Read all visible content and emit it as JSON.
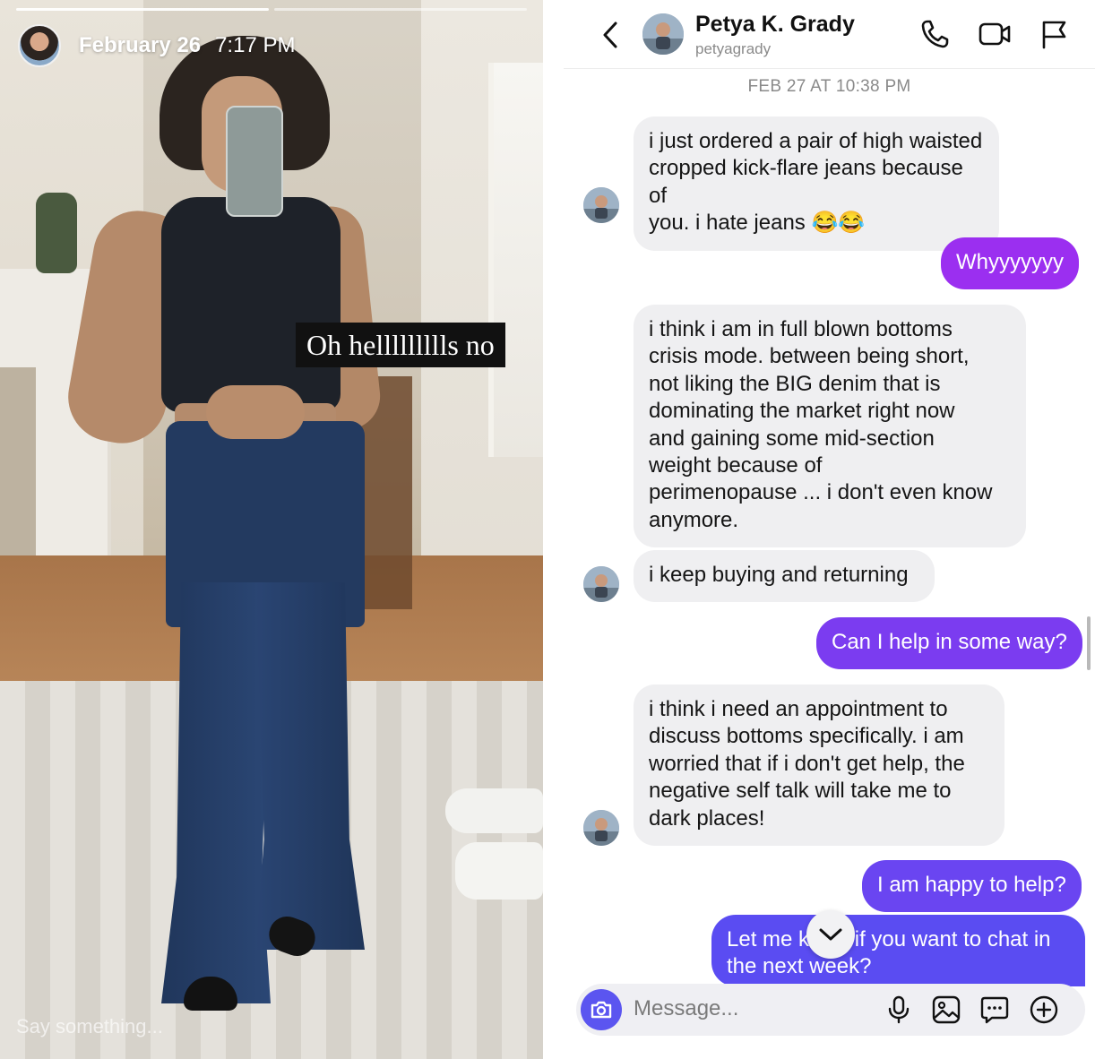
{
  "story": {
    "date": "February 26",
    "time": "7:17 PM",
    "caption": "Oh hellllllllls no",
    "reply_placeholder": "Say something..."
  },
  "dm": {
    "header": {
      "name": "Petya K. Grady",
      "handle": "petyagrady"
    },
    "timestamp": "FEB 27 AT 10:38 PM",
    "messages": [
      {
        "from": "them",
        "lines": [
          "i just ordered a pair of high waisted",
          "cropped kick-flare jeans because of",
          "you. i hate jeans 😂😂"
        ]
      },
      {
        "from": "me",
        "lines": [
          "Whyyyyyyy"
        ]
      },
      {
        "from": "them",
        "lines": [
          "i think i am in full blown bottoms",
          "crisis mode. between being short,",
          "not liking the BIG denim that is",
          "dominating the market right now",
          "and gaining some mid-section",
          "weight because of",
          "perimenopause ... i don't even know",
          "anymore."
        ]
      },
      {
        "from": "them",
        "lines": [
          "i keep buying and returning"
        ]
      },
      {
        "from": "me",
        "lines": [
          "Can I help in some way?"
        ]
      },
      {
        "from": "them",
        "lines": [
          "i think i need an appointment to",
          "discuss bottoms specifically. i am",
          "worried that if i don't get help, the",
          "negative self talk will take me to",
          "dark places!"
        ]
      },
      {
        "from": "me",
        "lines": [
          "I am happy to help?"
        ]
      },
      {
        "from": "me",
        "lines": [
          "Let me know if you want to chat in",
          "the next week?"
        ]
      }
    ],
    "composer_placeholder": "Message...",
    "colors": {
      "outgoing_top": "#9b2ff0",
      "outgoing_mid": "#7b3cf0",
      "outgoing_bottom": "#5a4cf2",
      "incoming": "#efeff1",
      "camera_button": "#5b55f0"
    },
    "icons": [
      "back-chevron-icon",
      "phone-icon",
      "video-camera-icon",
      "flag-icon",
      "camera-icon",
      "microphone-icon",
      "image-icon",
      "sticker-chat-icon",
      "plus-circle-icon",
      "chevron-down-icon"
    ]
  }
}
